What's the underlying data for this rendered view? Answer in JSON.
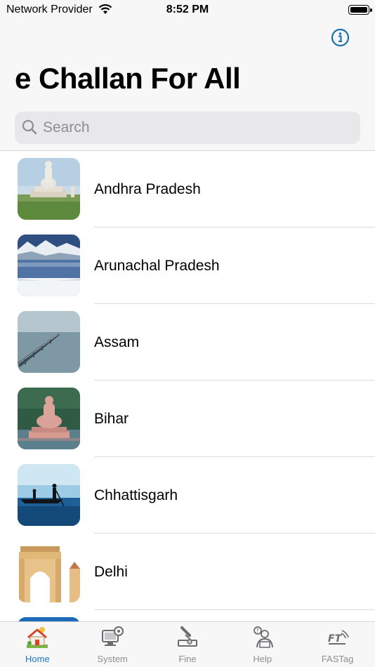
{
  "status_bar": {
    "carrier": "Network Provider",
    "time": "8:52 PM"
  },
  "header": {
    "title": "e Challan For All",
    "info_icon": "info-circle-icon"
  },
  "search": {
    "placeholder": "Search",
    "value": ""
  },
  "states": [
    {
      "name": "Andhra Pradesh",
      "image": "buddha-statue-thumbnail"
    },
    {
      "name": "Arunachal Pradesh",
      "image": "snowy-lake-thumbnail"
    },
    {
      "name": "Assam",
      "image": "bridge-over-river-thumbnail"
    },
    {
      "name": "Bihar",
      "image": "buddha-in-lake-thumbnail"
    },
    {
      "name": "Chhattisgarh",
      "image": "boatmen-on-lake-thumbnail"
    },
    {
      "name": "Delhi",
      "image": "india-gate-thumbnail"
    }
  ],
  "tabs": [
    {
      "label": "Home",
      "icon": "home-icon",
      "active": true
    },
    {
      "label": "System",
      "icon": "system-icon",
      "active": false
    },
    {
      "label": "Fine",
      "icon": "fine-icon",
      "active": false
    },
    {
      "label": "Help",
      "icon": "help-icon",
      "active": false
    },
    {
      "label": "FASTag",
      "icon": "fastag-icon",
      "active": false
    }
  ],
  "colors": {
    "accent": "#1477d2",
    "info_icon": "#1b6fa8",
    "tab_inactive": "#8e8e93"
  }
}
